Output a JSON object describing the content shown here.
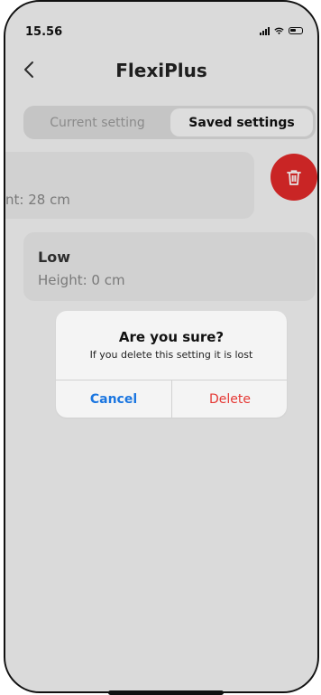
{
  "status_bar": {
    "time": "15.56",
    "signal_icon": "signal-icon",
    "wifi_icon": "wifi-icon",
    "battery_icon": "battery-icon"
  },
  "header": {
    "title": "FlexiPlus",
    "back_icon": "chevron-left-icon"
  },
  "tabs": [
    {
      "label": "Current setting",
      "active": false
    },
    {
      "label": "Saved settings",
      "active": true
    }
  ],
  "settings": [
    {
      "name": "",
      "height_text": "nt: 28 cm"
    },
    {
      "name": "Low",
      "height_text": "Height: 0 cm"
    }
  ],
  "delete_fab": {
    "icon": "trash-icon",
    "color": "#e02a2a"
  },
  "dialog": {
    "title": "Are you sure?",
    "message": "If you delete this setting it is lost",
    "cancel_label": "Cancel",
    "delete_label": "Delete",
    "cancel_color": "#1b76e0",
    "delete_color": "#e53935"
  }
}
